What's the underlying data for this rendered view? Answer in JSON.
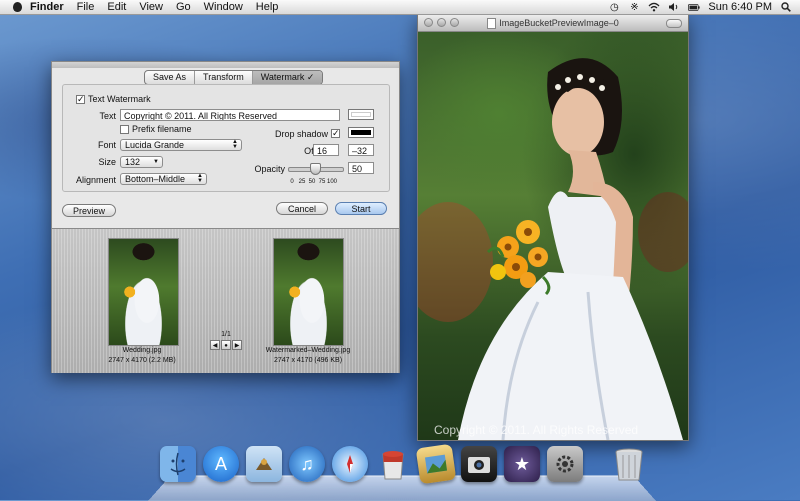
{
  "menubar": {
    "app_name": "Finder",
    "items": [
      "File",
      "Edit",
      "View",
      "Go",
      "Window",
      "Help"
    ],
    "clock": "Sun 6:40 PM"
  },
  "dialog": {
    "tabs": [
      "Save As",
      "Transform",
      "Watermark ✓"
    ],
    "text_watermark_label": "Text Watermark",
    "text_watermark_checked": true,
    "text_label": "Text",
    "text_value": "Copyright © 2011. All Rights Reserved",
    "prefix_filename_label": "Prefix filename",
    "prefix_filename_checked": false,
    "font_label": "Font",
    "font_value": "Lucida Grande",
    "size_label": "Size",
    "size_value": "132",
    "alignment_label": "Alignment",
    "alignment_value": "Bottom–Middle",
    "drop_shadow_label": "Drop shadow",
    "drop_shadow_checked": true,
    "text_color": "#ffffff",
    "shadow_color": "#000000",
    "offset_label": "Offset",
    "offset_x": "16",
    "offset_y": "–32",
    "opacity_label": "Opacity",
    "opacity_value": "50",
    "opacity_ticks": [
      "0",
      "25",
      "50",
      "75",
      "100"
    ],
    "preview_button": "Preview",
    "cancel_button": "Cancel",
    "start_button": "Start",
    "preview": {
      "original_name": "Wedding.jpg",
      "original_info": "2747 x 4170 (2.2 MB)",
      "watermarked_name": "Watermarked–Wedding.jpg",
      "watermarked_info": "2747 x 4170 (496 KB)",
      "page_indicator": "1/1"
    }
  },
  "image_window": {
    "title": "ImageBucketPreviewImage–0",
    "watermark_text": "Copyright © 2011. All Rights Reserved"
  },
  "dock": {
    "apps": [
      "finder-icon",
      "app-store-icon",
      "preview-icon",
      "itunes-icon",
      "safari-icon",
      "paint-bucket-icon",
      "iphoto-icon",
      "photo-booth-icon",
      "imovie-icon",
      "system-preferences-icon",
      "trash-icon"
    ]
  }
}
